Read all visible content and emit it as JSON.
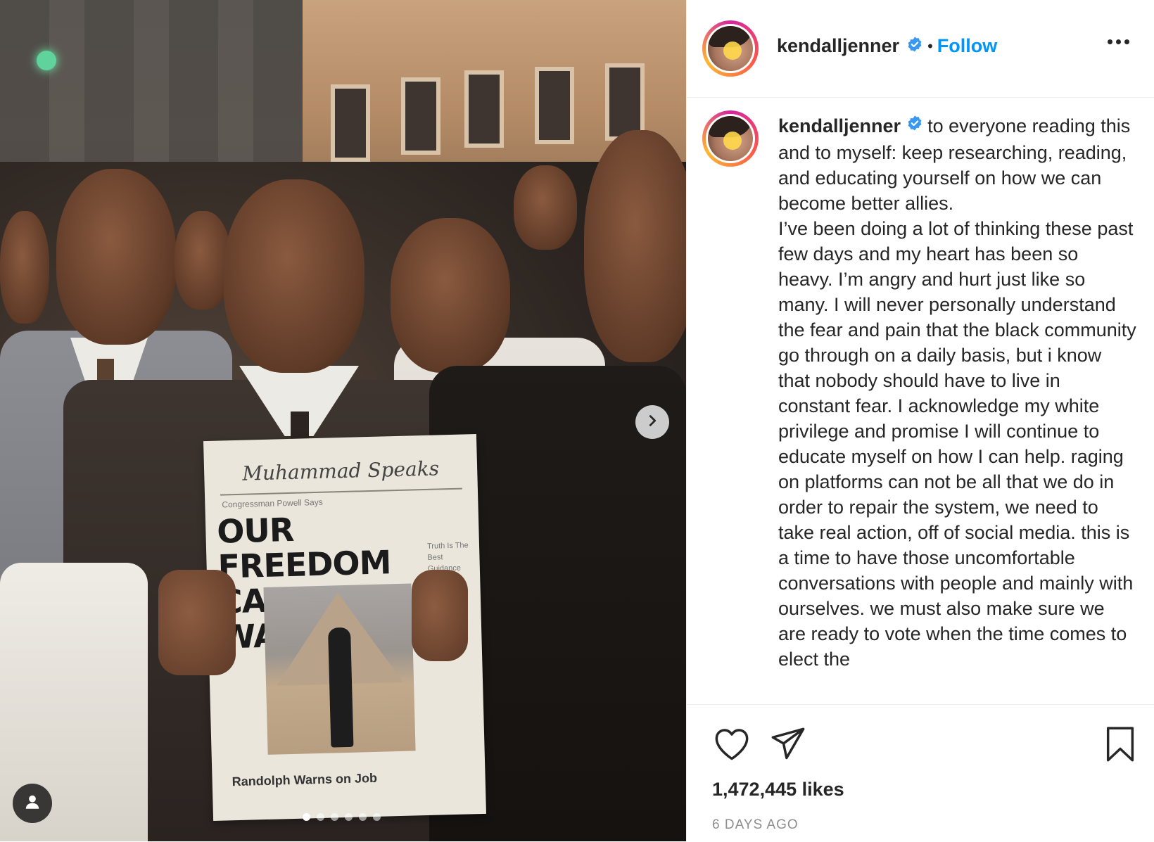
{
  "post": {
    "author": {
      "username": "kendalljenner",
      "verified": true,
      "avatar_icon": "profile-photo"
    },
    "header": {
      "separator": "•",
      "follow_label": "Follow",
      "more_icon": "more-options-icon"
    },
    "caption": {
      "username": "kendalljenner",
      "text": "to everyone reading this and to myself: keep researching, reading, and educating yourself on how we can become better allies.\nI’ve been doing a lot of thinking these past few days and my heart has been so heavy. I’m angry and hurt just like so many. I will never personally understand the fear and pain that the black community go through on a daily basis, but i know that nobody should have to live in constant fear. I acknowledge my white privilege and promise I will continue to educate myself on how I can help. raging on platforms can not be all that we do in order to repair the system, we need to take real action, off of social media. this is a time to have those uncomfortable conversations with people and mainly with ourselves. we must also make sure we are ready to vote when the time comes to elect the"
    },
    "media": {
      "newspaper_masthead": "Muhammad Speaks",
      "newspaper_subhead": "Congressman Powell Says",
      "newspaper_headline": "OUR FREEDOM CAN'T WAIT!",
      "newspaper_side": "Truth Is The Best Guidance",
      "newspaper_footer": "Randolph Warns on Job",
      "carousel_total": 6,
      "carousel_active": 1,
      "next_icon": "chevron-right-icon",
      "tag_icon": "user-tag-icon"
    },
    "stats": {
      "likes_label": "1,472,445 likes",
      "date_label": "6 DAYS AGO"
    },
    "actions": {
      "like_icon": "heart-icon",
      "share_icon": "send-icon",
      "save_icon": "bookmark-icon"
    },
    "colors": {
      "link_blue": "#0095f6",
      "verified_blue": "#3897f0",
      "text": "#262626",
      "muted": "#8e8e8e"
    }
  }
}
